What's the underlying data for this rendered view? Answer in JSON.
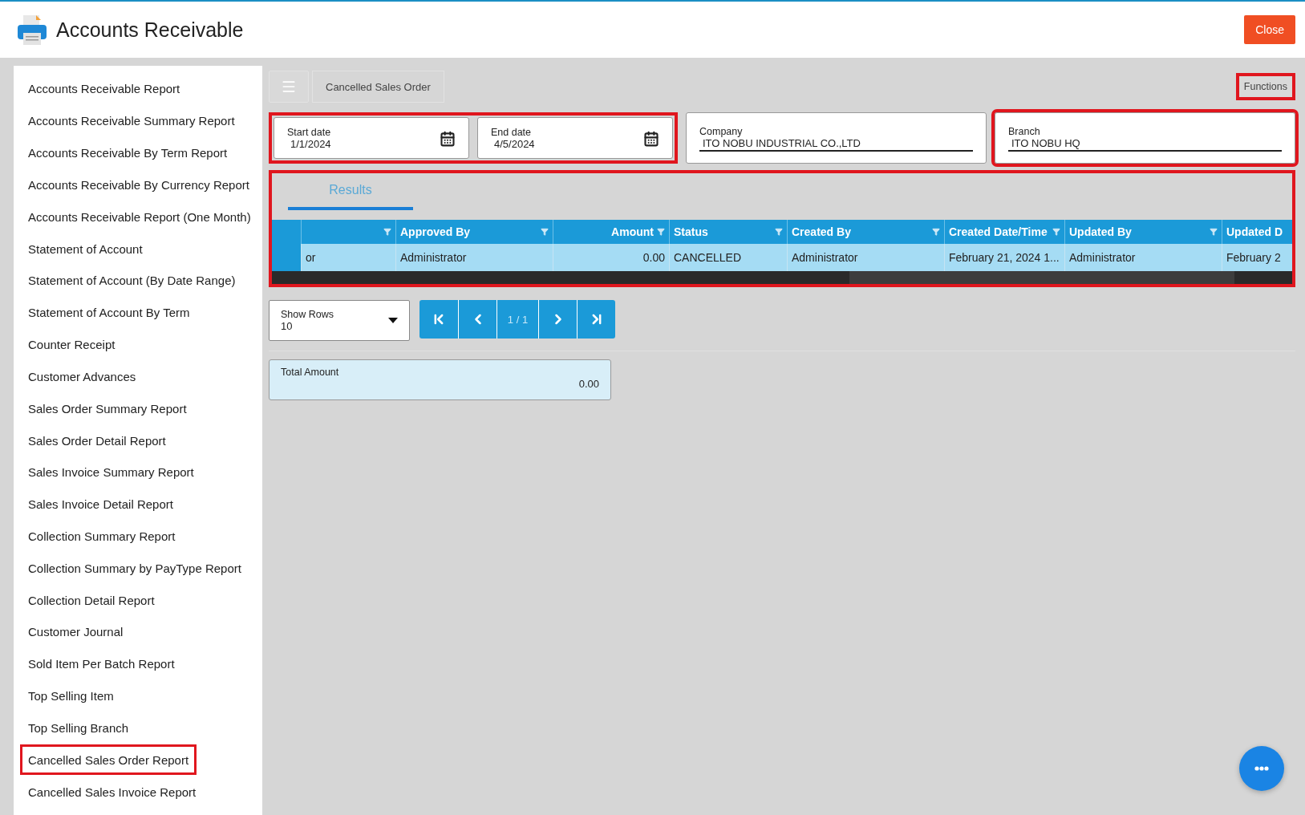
{
  "window": {
    "title": "Accounts Receivable",
    "close_button": "Close"
  },
  "sidebar": {
    "items": [
      {
        "label": "Accounts Receivable Report",
        "selected": false
      },
      {
        "label": "Accounts Receivable Summary Report",
        "selected": false
      },
      {
        "label": "Accounts Receivable By Term Report",
        "selected": false
      },
      {
        "label": "Accounts Receivable By Currency Report",
        "selected": false
      },
      {
        "label": "Accounts Receivable Report (One Month)",
        "selected": false
      },
      {
        "label": "Statement of Account",
        "selected": false
      },
      {
        "label": "Statement of Account (By Date Range)",
        "selected": false
      },
      {
        "label": "Statement of Account By Term",
        "selected": false
      },
      {
        "label": "Counter Receipt",
        "selected": false
      },
      {
        "label": "Customer Advances",
        "selected": false
      },
      {
        "label": "Sales Order Summary Report",
        "selected": false
      },
      {
        "label": "Sales Order Detail Report",
        "selected": false
      },
      {
        "label": "Sales Invoice Summary Report",
        "selected": false
      },
      {
        "label": "Sales Invoice Detail Report",
        "selected": false
      },
      {
        "label": "Collection Summary Report",
        "selected": false
      },
      {
        "label": "Collection Summary by PayType Report",
        "selected": false
      },
      {
        "label": "Collection Detail Report",
        "selected": false
      },
      {
        "label": "Customer Journal",
        "selected": false
      },
      {
        "label": "Sold Item Per Batch Report",
        "selected": false
      },
      {
        "label": "Top Selling Item",
        "selected": false
      },
      {
        "label": "Top Selling Branch",
        "selected": false
      },
      {
        "label": "Cancelled Sales Order Report",
        "selected": true
      },
      {
        "label": "Cancelled Sales Invoice Report",
        "selected": false
      }
    ]
  },
  "toolbar": {
    "breadcrumb": "Cancelled Sales Order",
    "functions_button": {
      "label": "Functions",
      "highlighted": true
    }
  },
  "filters": {
    "dates_highlighted": true,
    "start_date": {
      "label": "Start date",
      "value": "1/1/2024"
    },
    "end_date": {
      "label": "End date",
      "value": "4/5/2024"
    },
    "company": {
      "label": "Company",
      "value": "ITO NOBU INDUSTRIAL CO.,LTD",
      "highlighted": false
    },
    "branch": {
      "label": "Branch",
      "value": "ITO NOBU HQ",
      "highlighted": true
    }
  },
  "results": {
    "highlighted": true,
    "tabs": [
      {
        "label": "Results",
        "selected": true
      }
    ],
    "table": {
      "columns": [
        {
          "filter": true,
          "kind": "text"
        },
        {
          "label": "Approved By",
          "filter": true,
          "kind": "text"
        },
        {
          "label": "Amount",
          "filter": true,
          "kind": "number"
        },
        {
          "label": "Status",
          "filter": true,
          "kind": "text"
        },
        {
          "label": "Created By",
          "filter": true,
          "kind": "text"
        },
        {
          "label": "Created Date/Time",
          "filter": true,
          "kind": "text"
        },
        {
          "label": "Updated By",
          "filter": true,
          "kind": "text"
        },
        {
          "label": "Updated D",
          "filter": false,
          "kind": "text"
        }
      ],
      "rows": [
        {
          "selected": true,
          "cells": [
            "or",
            "Administrator",
            "0.00",
            "CANCELLED",
            "Administrator",
            "February 21, 2024 1...",
            "Administrator",
            "February 2"
          ]
        }
      ]
    }
  },
  "pagination": {
    "show_rows_label": "Show Rows",
    "show_rows_value": "10",
    "page": "1 / 1"
  },
  "total": {
    "label": "Total Amount",
    "value": "0.00"
  }
}
